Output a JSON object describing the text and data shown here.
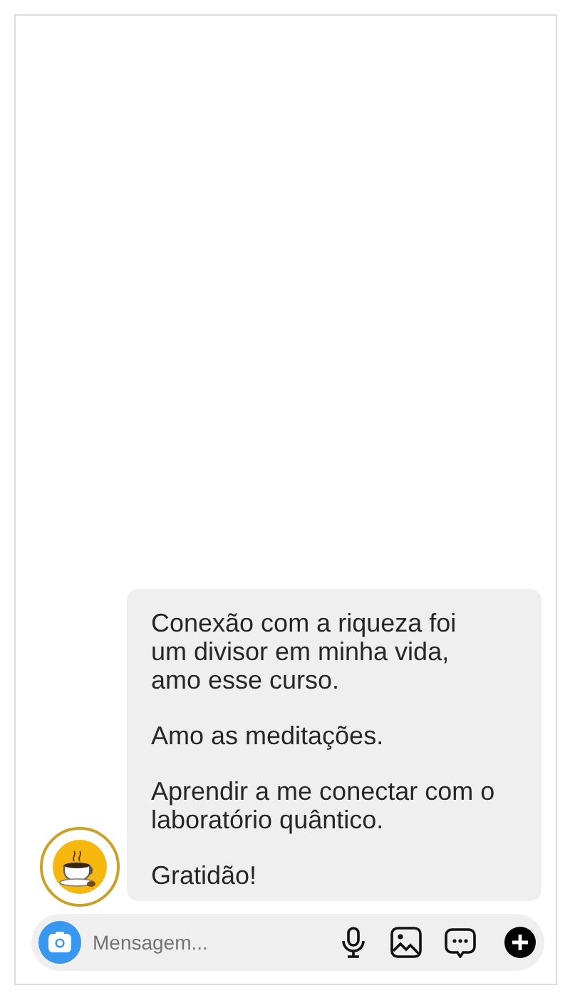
{
  "message": {
    "paragraphs": [
      "Conexão com a riqueza foi um divisor em minha vida, amo esse curso.",
      "Amo as meditações.",
      "Aprendir a me conectar com o laboratório quântico.",
      "Gratidão!"
    ]
  },
  "composer": {
    "placeholder": "Mensagem..."
  }
}
